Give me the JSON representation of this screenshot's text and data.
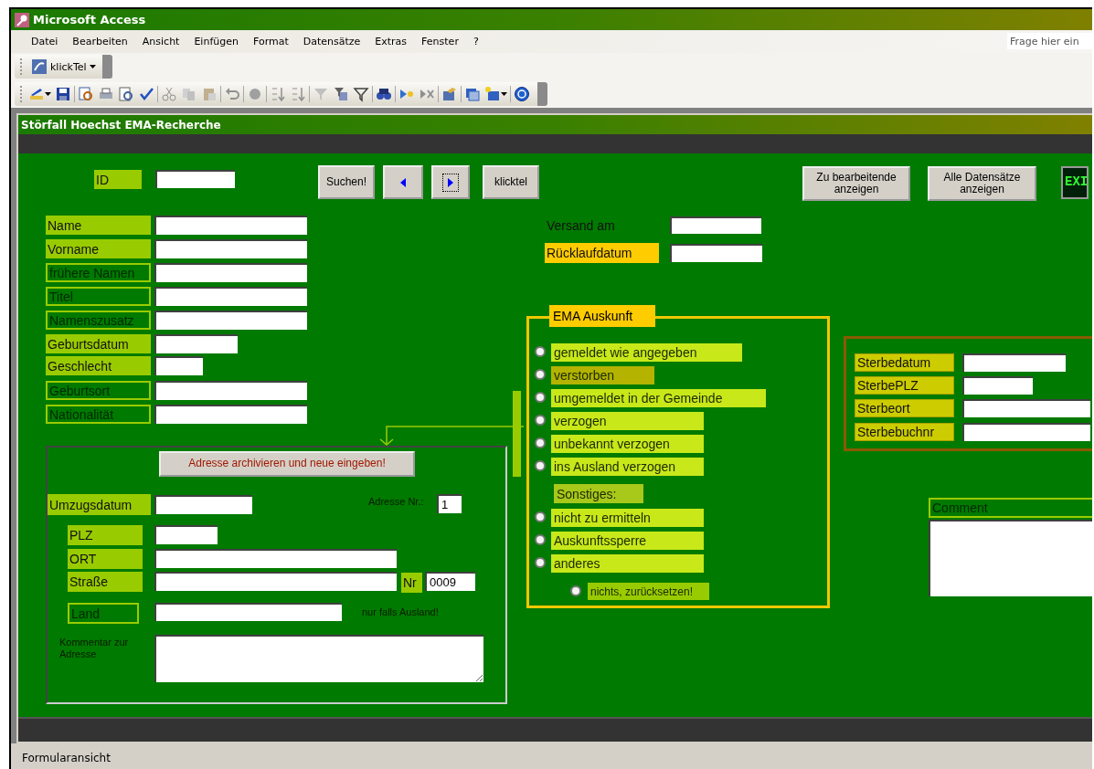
{
  "window": {
    "title": "Microsoft Access"
  },
  "menu": [
    "Datei",
    "Bearbeiten",
    "Ansicht",
    "Einfügen",
    "Format",
    "Datensätze",
    "Extras",
    "Fenster",
    "?"
  ],
  "help_box": {
    "placeholder": "Frage hier ein"
  },
  "klicktel_toolbar": {
    "label": "klickTel"
  },
  "form": {
    "title": "Störfall Hoechst EMA-Recherche",
    "id_label": "ID",
    "buttons": [
      {
        "kind": "text",
        "label": "Suchen!",
        "focused": false
      },
      {
        "kind": "prev",
        "focused": false
      },
      {
        "kind": "next",
        "focused": true
      },
      {
        "kind": "text",
        "label": "klicktel",
        "focused": false
      },
      {
        "kind": "text",
        "label": "Zu bearbeitende anzeigen",
        "focused": false
      },
      {
        "kind": "text",
        "label": "Alle Datensätze anzeigen",
        "focused": false
      },
      {
        "kind": "exit",
        "label": "EXI",
        "focused": false
      }
    ],
    "person_fields": [
      {
        "label": "Name",
        "kind": "fill"
      },
      {
        "label": "Vorname",
        "kind": "fill"
      },
      {
        "label": "frühere Namen",
        "kind": "outline"
      },
      {
        "label": "Titel",
        "kind": "outline"
      },
      {
        "label": "Namenszusatz",
        "kind": "outline"
      },
      {
        "label": "Geburtsdatum",
        "kind": "fill"
      },
      {
        "label": "Geschlecht",
        "kind": "fill"
      },
      {
        "label": "Geburtsort",
        "kind": "outline"
      },
      {
        "label": "Nationalität",
        "kind": "outline"
      }
    ],
    "dispatch_fields": [
      {
        "label": "Versand am",
        "kind": "plain"
      },
      {
        "label": "Rücklaufdatum",
        "kind": "orange"
      }
    ],
    "ema_group": {
      "title": "EMA Auskunft",
      "options": [
        {
          "kind": "option",
          "label": "gemeldet wie angegeben",
          "selected": false,
          "color": "#c8e81a"
        },
        {
          "kind": "option",
          "label": "verstorben",
          "selected": false,
          "color": "#b3b300"
        },
        {
          "kind": "option",
          "label": "umgemeldet in der Gemeinde",
          "selected": false,
          "color": "#c8e81a"
        },
        {
          "kind": "option",
          "label": "verzogen",
          "selected": false,
          "color": "#c8e81a"
        },
        {
          "kind": "option",
          "label": "unbekannt verzogen",
          "selected": false,
          "color": "#c8e81a"
        },
        {
          "kind": "option",
          "label": "ins Ausland verzogen",
          "selected": false,
          "color": "#c8e81a"
        },
        {
          "kind": "heading",
          "label": "Sonstiges:",
          "color": "#a8c81a"
        },
        {
          "kind": "option",
          "label": "nicht zu ermitteln",
          "selected": false,
          "color": "#c8e81a"
        },
        {
          "kind": "option",
          "label": "Auskunftssperre",
          "selected": false,
          "color": "#c8e81a"
        },
        {
          "kind": "option",
          "label": "anderes",
          "selected": false,
          "color": "#c8e81a"
        },
        {
          "kind": "reset",
          "label": "nichts, zurücksetzen!",
          "selected": false,
          "color": "#99cc00"
        }
      ]
    },
    "death_fields": [
      {
        "label": "Sterbedatum",
        "kind": "yellow"
      },
      {
        "label": "SterbePLZ",
        "kind": "yellow"
      },
      {
        "label": "Sterbeort",
        "kind": "yellow"
      },
      {
        "label": "Sterbebuchnr",
        "kind": "yellow"
      }
    ],
    "comment": {
      "label": "Comment",
      "kind": "outline"
    },
    "address": {
      "archive_button": "Adresse archivieren und neue eingeben!",
      "move_date_label": {
        "label": "Umzugsdatum",
        "kind": "fill"
      },
      "address_no_label": "Adresse Nr.:",
      "address_no": "1",
      "fields": [
        {
          "label": "PLZ",
          "kind": "fill"
        },
        {
          "label": "ORT",
          "kind": "fill"
        },
        {
          "label": "Straße",
          "kind": "fill"
        }
      ],
      "house_no_label": {
        "label": "Nr",
        "kind": "fill"
      },
      "house_no": "0009",
      "country": {
        "label": "Land",
        "kind": "outline"
      },
      "country_hint": "nur falls Ausland!",
      "comment_label": "Kommentar zur Adresse"
    }
  },
  "status_bar": {
    "text": "Formularansicht"
  }
}
